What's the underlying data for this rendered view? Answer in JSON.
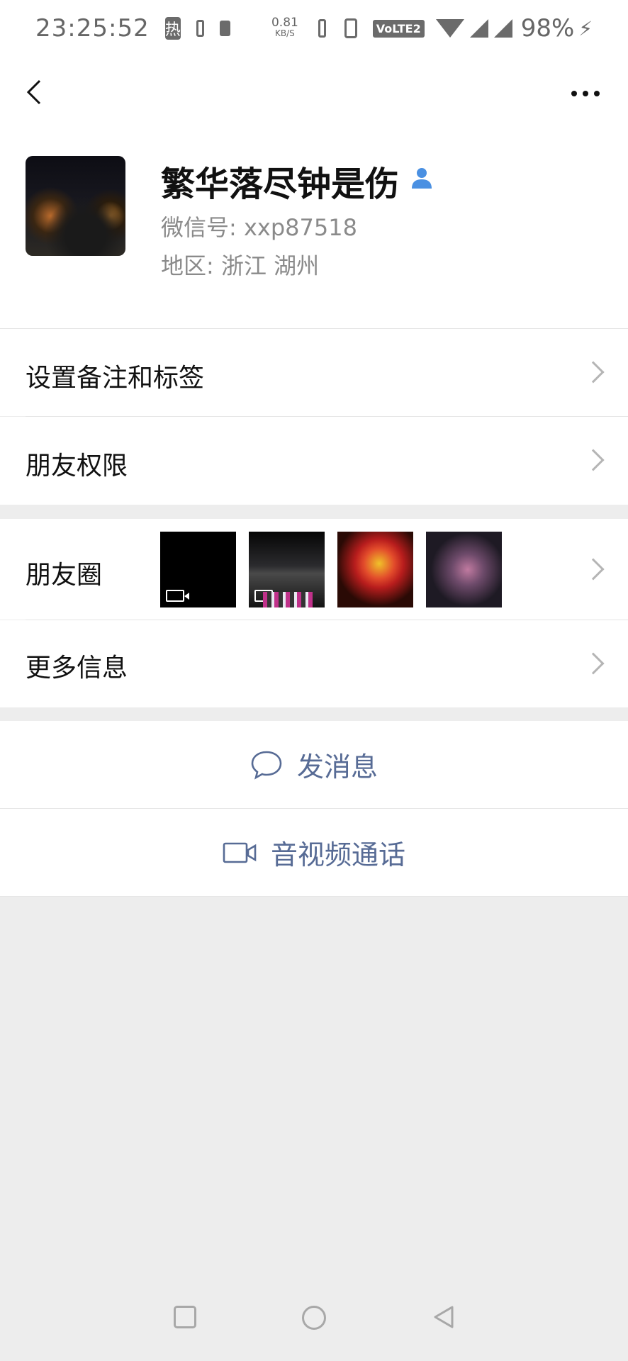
{
  "status_bar": {
    "time": "23:25:52",
    "hot_badge": "热",
    "speed_value": "0.81",
    "speed_unit": "KB/S",
    "volte": "VoLTE2",
    "battery": "98%"
  },
  "header": {
    "back_icon": "chevron-left-icon",
    "more_icon": "more-dots-icon"
  },
  "profile": {
    "name": "繁华落尽钟是伤",
    "wechat_id": "微信号:  xxp87518",
    "region": "地区:  浙江   湖州"
  },
  "rows": {
    "remark": "设置备注和标签",
    "permissions": "朋友权限",
    "moments": "朋友圈",
    "more_info": "更多信息"
  },
  "actions": {
    "message": "发消息",
    "video_call": "音视频通话"
  },
  "colors": {
    "link_blue": "#576b95",
    "background": "#ededed",
    "icon_blue": "#4a90e2"
  }
}
